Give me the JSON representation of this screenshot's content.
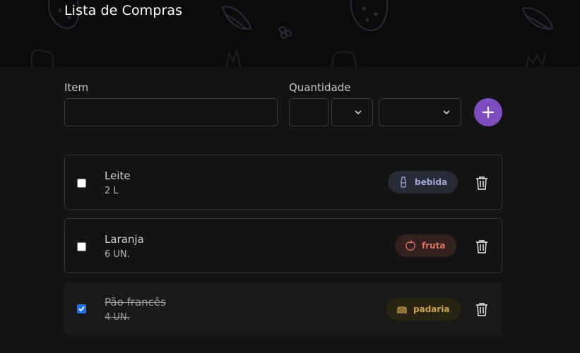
{
  "app": {
    "title": "Lista de Compras"
  },
  "form": {
    "item_label": "Item",
    "item_value": "",
    "quantity_label": "Quantidade",
    "quantity_value": "",
    "unit_value": "",
    "category_value": "",
    "add_icon": "plus-icon"
  },
  "items": [
    {
      "name": "Leite",
      "quantity": "2 L",
      "checked": false,
      "category": "bebida",
      "category_icon": "bottle-icon",
      "color": "#9ca8d4",
      "bg": "#262b36"
    },
    {
      "name": "Laranja",
      "quantity": "6 UN.",
      "checked": false,
      "category": "fruta",
      "category_icon": "apple-icon",
      "color": "#e3735c",
      "bg": "#33211d"
    },
    {
      "name": "Pão francês",
      "quantity": "4 UN.",
      "checked": true,
      "category": "padaria",
      "category_icon": "sandwich-icon",
      "color": "#c9a44a",
      "bg": "#2a2415"
    }
  ],
  "colors": {
    "accent": "#7e4dbf",
    "background": "#131313",
    "border": "#343434"
  }
}
